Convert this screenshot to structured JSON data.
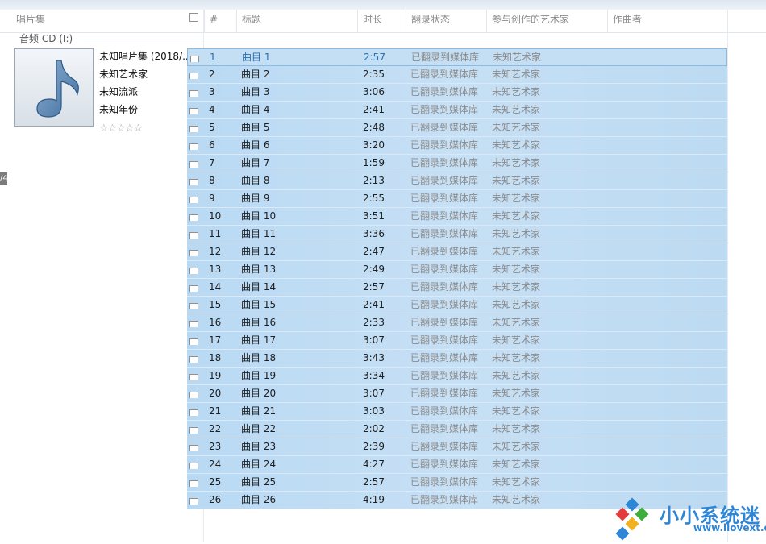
{
  "header": {
    "album_col": "唱片集",
    "num_col": "#",
    "title_col": "标题",
    "duration_col": "时长",
    "rip_status_col": "翻录状态",
    "artists_col": "参与创作的艺术家",
    "composer_col": "作曲者"
  },
  "group_label": "音频 CD (I:)",
  "album": {
    "title": "未知唱片集 (2018/...",
    "artist": "未知艺术家",
    "genre": "未知流派",
    "year": "未知年份",
    "rating_stars": 0,
    "art_icon": "music-note-icon"
  },
  "left_edge_mark": "/4",
  "tracks": [
    {
      "num": "1",
      "title": "曲目 1",
      "duration": "2:57",
      "rip": "已翻录到媒体库",
      "artist": "未知艺术家"
    },
    {
      "num": "2",
      "title": "曲目 2",
      "duration": "2:35",
      "rip": "已翻录到媒体库",
      "artist": "未知艺术家"
    },
    {
      "num": "3",
      "title": "曲目 3",
      "duration": "3:06",
      "rip": "已翻录到媒体库",
      "artist": "未知艺术家"
    },
    {
      "num": "4",
      "title": "曲目 4",
      "duration": "2:41",
      "rip": "已翻录到媒体库",
      "artist": "未知艺术家"
    },
    {
      "num": "5",
      "title": "曲目 5",
      "duration": "2:48",
      "rip": "已翻录到媒体库",
      "artist": "未知艺术家"
    },
    {
      "num": "6",
      "title": "曲目 6",
      "duration": "3:20",
      "rip": "已翻录到媒体库",
      "artist": "未知艺术家"
    },
    {
      "num": "7",
      "title": "曲目 7",
      "duration": "1:59",
      "rip": "已翻录到媒体库",
      "artist": "未知艺术家"
    },
    {
      "num": "8",
      "title": "曲目 8",
      "duration": "2:13",
      "rip": "已翻录到媒体库",
      "artist": "未知艺术家"
    },
    {
      "num": "9",
      "title": "曲目 9",
      "duration": "2:55",
      "rip": "已翻录到媒体库",
      "artist": "未知艺术家"
    },
    {
      "num": "10",
      "title": "曲目 10",
      "duration": "3:51",
      "rip": "已翻录到媒体库",
      "artist": "未知艺术家"
    },
    {
      "num": "11",
      "title": "曲目 11",
      "duration": "3:36",
      "rip": "已翻录到媒体库",
      "artist": "未知艺术家"
    },
    {
      "num": "12",
      "title": "曲目 12",
      "duration": "2:47",
      "rip": "已翻录到媒体库",
      "artist": "未知艺术家"
    },
    {
      "num": "13",
      "title": "曲目 13",
      "duration": "2:49",
      "rip": "已翻录到媒体库",
      "artist": "未知艺术家"
    },
    {
      "num": "14",
      "title": "曲目 14",
      "duration": "2:57",
      "rip": "已翻录到媒体库",
      "artist": "未知艺术家"
    },
    {
      "num": "15",
      "title": "曲目 15",
      "duration": "2:41",
      "rip": "已翻录到媒体库",
      "artist": "未知艺术家"
    },
    {
      "num": "16",
      "title": "曲目 16",
      "duration": "2:33",
      "rip": "已翻录到媒体库",
      "artist": "未知艺术家"
    },
    {
      "num": "17",
      "title": "曲目 17",
      "duration": "3:07",
      "rip": "已翻录到媒体库",
      "artist": "未知艺术家"
    },
    {
      "num": "18",
      "title": "曲目 18",
      "duration": "3:43",
      "rip": "已翻录到媒体库",
      "artist": "未知艺术家"
    },
    {
      "num": "19",
      "title": "曲目 19",
      "duration": "3:34",
      "rip": "已翻录到媒体库",
      "artist": "未知艺术家"
    },
    {
      "num": "20",
      "title": "曲目 20",
      "duration": "3:07",
      "rip": "已翻录到媒体库",
      "artist": "未知艺术家"
    },
    {
      "num": "21",
      "title": "曲目 21",
      "duration": "3:03",
      "rip": "已翻录到媒体库",
      "artist": "未知艺术家"
    },
    {
      "num": "22",
      "title": "曲目 22",
      "duration": "2:02",
      "rip": "已翻录到媒体库",
      "artist": "未知艺术家"
    },
    {
      "num": "23",
      "title": "曲目 23",
      "duration": "2:39",
      "rip": "已翻录到媒体库",
      "artist": "未知艺术家"
    },
    {
      "num": "24",
      "title": "曲目 24",
      "duration": "4:27",
      "rip": "已翻录到媒体库",
      "artist": "未知艺术家"
    },
    {
      "num": "25",
      "title": "曲目 25",
      "duration": "2:57",
      "rip": "已翻录到媒体库",
      "artist": "未知艺术家"
    },
    {
      "num": "26",
      "title": "曲目 26",
      "duration": "4:19",
      "rip": "已翻录到媒体库",
      "artist": "未知艺术家"
    }
  ],
  "selected_track": "1",
  "watermark": {
    "name_cn": "小小系统迷",
    "url": "www.ilovext.com"
  },
  "colors": {
    "row_fill": "#bcdaf2",
    "selected_text": "#2a6fb0",
    "muted_text": "#8a8a8a",
    "brand": "#2f86d6"
  }
}
